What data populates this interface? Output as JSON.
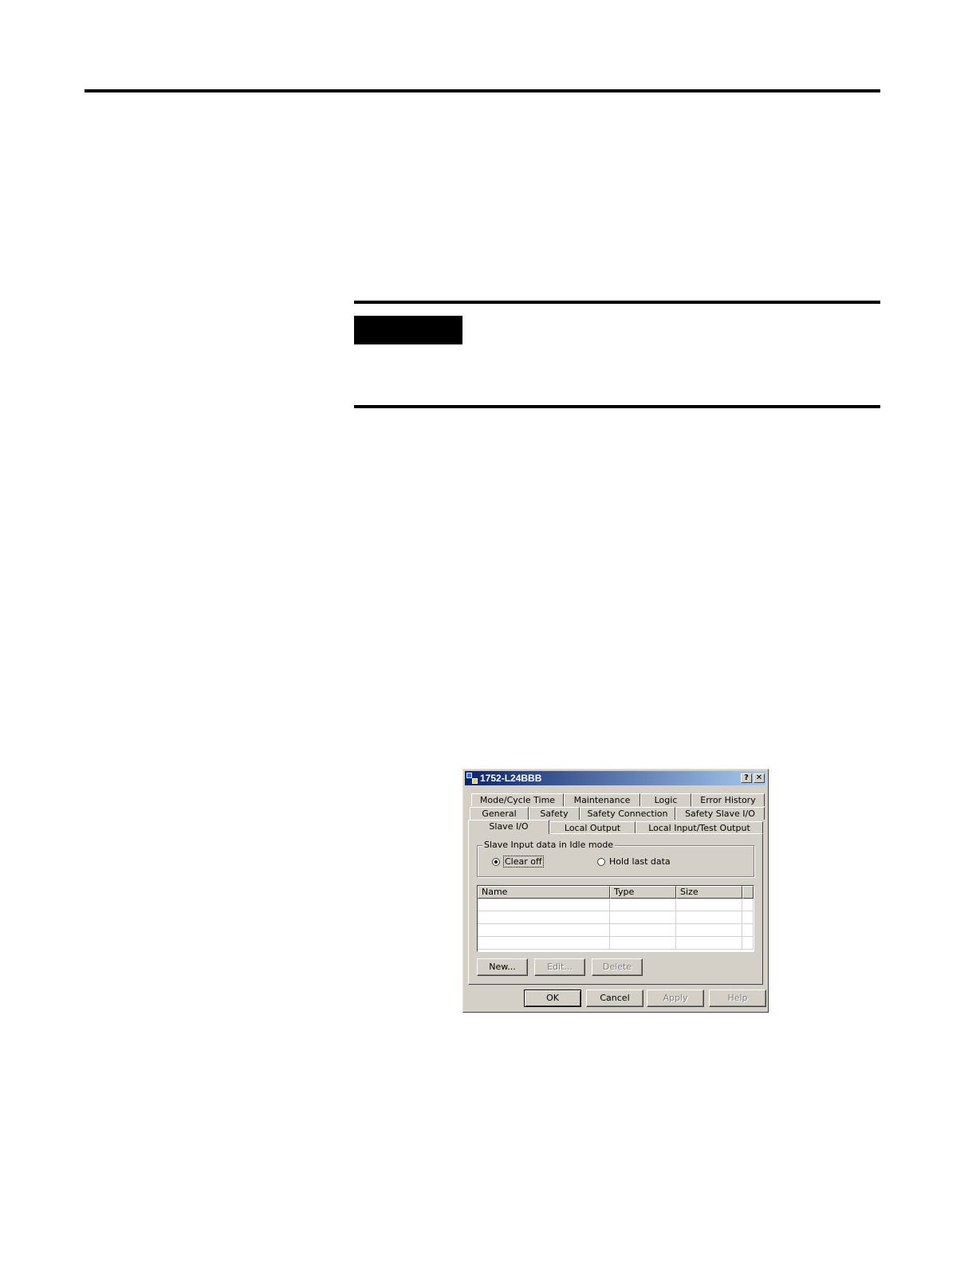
{
  "dialog": {
    "title": "1752-L24BBB",
    "help_glyph": "?",
    "close_glyph": "✕",
    "tabs_row1": [
      "Mode/Cycle Time",
      "Maintenance",
      "Logic",
      "Error History"
    ],
    "tabs_row2": [
      "General",
      "Safety",
      "Safety Connection",
      "Safety Slave I/O"
    ],
    "tabs_row3": [
      "Slave I/O",
      "Local Output",
      "Local Input/Test Output"
    ],
    "active_tab": "Slave I/O",
    "group": {
      "label": "Slave Input data in Idle mode",
      "option_clear": "Clear off",
      "option_hold": "Hold last data",
      "selected": "Clear off"
    },
    "table": {
      "columns": [
        "Name",
        "Type",
        "Size"
      ],
      "rows": []
    },
    "buttons": {
      "new": "New...",
      "edit": "Edit...",
      "delete": "Delete",
      "ok": "OK",
      "cancel": "Cancel",
      "apply": "Apply",
      "help": "Help"
    }
  }
}
